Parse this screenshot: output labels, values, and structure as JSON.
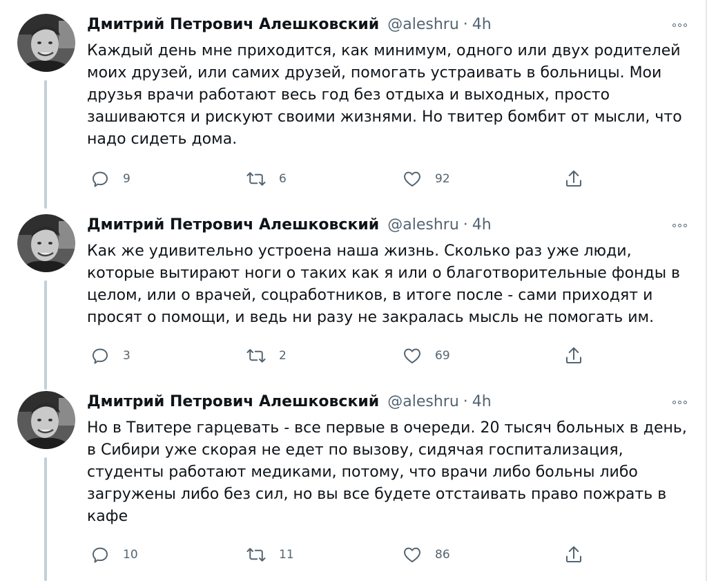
{
  "tweets": [
    {
      "author_name": "Дмитрий Петрович Алешковский",
      "handle": "@aleshru",
      "separator": "·",
      "time": "4h",
      "text": "Каждый день мне приходится, как минимум, одного или двух родителей моих друзей, или самих друзей, помогать устраивать в больницы. Мои друзья врачи работают весь год без отдыха и выходных, просто зашиваются и рискуют своими жизнями. Но твитер бомбит от мысли, что надо сидеть дома.",
      "replies": "9",
      "retweets": "6",
      "likes": "92"
    },
    {
      "author_name": "Дмитрий Петрович Алешковский",
      "handle": "@aleshru",
      "separator": "·",
      "time": "4h",
      "text": "Как же удивительно устроена наша жизнь. Сколько раз уже люди, которые вытирают ноги о таких как я или о благотворительные фонды в целом, или о врачей, соцработников, в итоге после - сами приходят и просят о помощи, и ведь ни разу не закралась мысль не помогать им.",
      "replies": "3",
      "retweets": "2",
      "likes": "69"
    },
    {
      "author_name": "Дмитрий Петрович Алешковский",
      "handle": "@aleshru",
      "separator": "·",
      "time": "4h",
      "text": "Но в Твитере гарцевать - все первые в очереди. 20 тысяч больных в день, в Сибири уже скорая не едет по вызову, сидячая госпитализация, студенты работают медиками, потому, что врачи либо больны либо загружены либо без сил, но вы все будете отстаивать право пожрать в кафе",
      "replies": "10",
      "retweets": "11",
      "likes": "86"
    }
  ],
  "icons": {
    "reply": "reply-icon",
    "retweet": "retweet-icon",
    "like": "heart-icon",
    "share": "share-icon",
    "more": "more-icon"
  },
  "colors": {
    "text": "#0f1419",
    "secondary": "#536471",
    "thread_line": "#c4cfd6"
  }
}
